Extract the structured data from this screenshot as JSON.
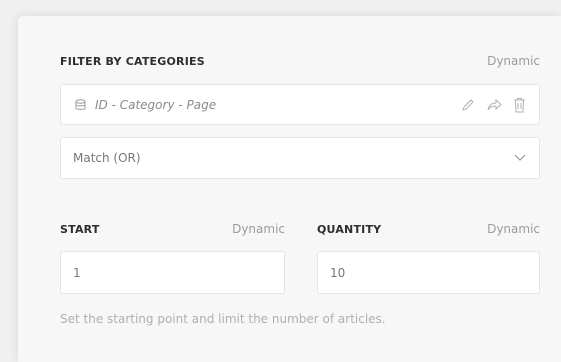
{
  "filter": {
    "label": "FILTER BY CATEGORIES",
    "dynamic": "Dynamic",
    "source": {
      "text": "ID - Category - Page",
      "icons": [
        "database-icon",
        "pencil-icon",
        "share-icon",
        "trash-icon"
      ]
    },
    "match": {
      "value": "Match (OR)",
      "icon": "chevron-down-icon"
    }
  },
  "start": {
    "label": "START",
    "dynamic": "Dynamic",
    "value": "1"
  },
  "quantity": {
    "label": "QUANTITY",
    "dynamic": "Dynamic",
    "value": "10"
  },
  "help_text": "Set the starting point and limit the number of articles.",
  "colors": {
    "panel_bg": "#f7f7f7",
    "field_bg": "#ffffff",
    "border": "#e4e4e4",
    "muted": "#9b9b9b"
  }
}
